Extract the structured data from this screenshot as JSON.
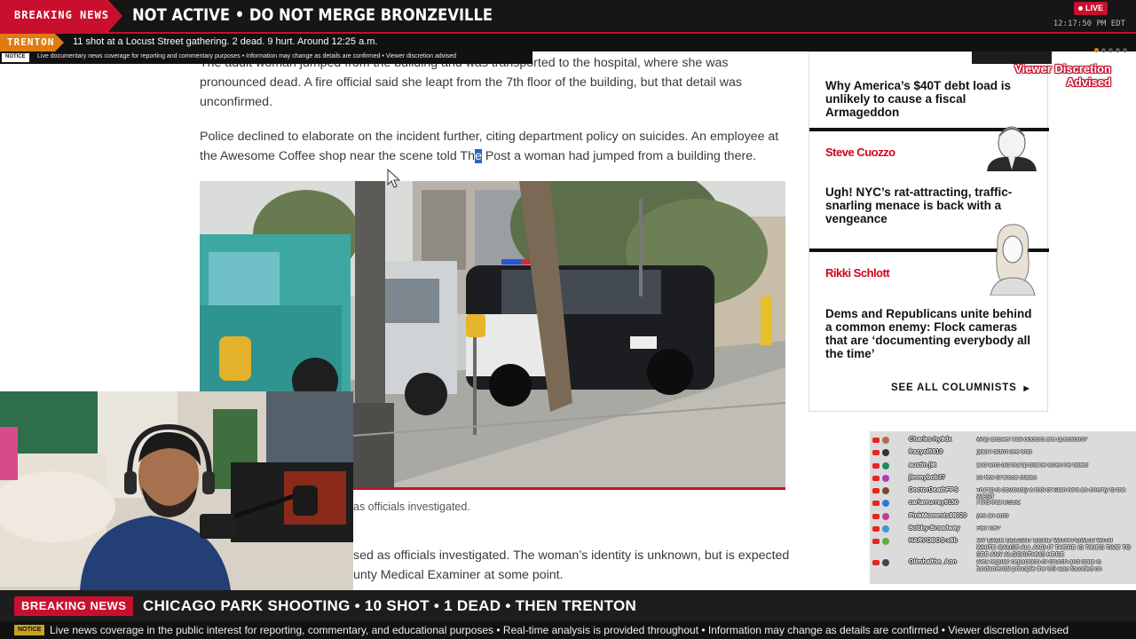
{
  "top_bar": {
    "breaking_label": "BREAKING NEWS",
    "headline": "NOT ACTIVE • DO NOT MERGE BRONZEVILLE",
    "live_label": "LIVE",
    "clock": "12:17:50 PM EDT"
  },
  "ticker2": {
    "tag": "TRENTON",
    "text": "11 shot at a Locust Street gathering. 2 dead. 9 hurt. Around 12:25 a.m."
  },
  "notice_strip": {
    "tag": "NOTICE",
    "text": "Live documentary news coverage for reporting and commentary purposes • Information may change as details are confirmed • Viewer discretion advised"
  },
  "article": {
    "para1": "The adult woman jumped from the building and was transported to the hospital, where she was pronounced dead. A fire official said she leapt from the 7th floor of the building, but that detail was unconfirmed.",
    "para2_before": "Police declined to elaborate on the incident further, citing department policy on suicides. An employee at the Awesome Coffee shop near the scene told Th",
    "para2_highlight": "e",
    "para2_after": " Post a woman had jumped from a building there.",
    "caption_visible": "as officials investigated.",
    "para3_line1": "sed as officials investigated. The woman’s identity is unknown, but is expected",
    "para3_line2": "unty Medical Examiner at some point."
  },
  "sidebar": {
    "headline1": "Why America’s $40T debt load is unlikely to cause a fiscal Armageddon",
    "author1": "Steve Cuozzo",
    "headline2": "Ugh! NYC’s rat-attracting, traffic-snarling menace is back with a vengeance",
    "author2": "Rikki Schlott",
    "headline3": "Dems and Republicans unite behind a common enemy: Flock cameras that are ‘documenting everybody all the time’",
    "see_all": "SEE ALL COLUMNISTS",
    "see_all_icon": "triangle-right-icon"
  },
  "viewer_discretion": "Viewer Discretion Advised",
  "chat": {
    "messages": [
      {
        "user": "Charles-hy9dx",
        "text": "Why answer that doctors are questions?",
        "avatar_color": "#b86b4b"
      },
      {
        "user": "frazyol5510",
        "text": "glad I didn't see that",
        "avatar_color": "#333333"
      },
      {
        "user": "austin j9t",
        "text": "and who did trump blame when he failed",
        "avatar_color": "#1f8a5b"
      },
      {
        "user": "jimmybob37",
        "text": "so few of those states",
        "avatar_color": "#b23bb5"
      },
      {
        "user": "DoctorDeathFPS",
        "text": "Trump is obviously a tool of Stan he's an enemy to the WEST",
        "avatar_color": "#7a4a2a"
      },
      {
        "user": "carlamurray9150",
        "text": "I find that BSBC",
        "avatar_color": "#2a7bd1"
      },
      {
        "user": "PinkMoments98020",
        "text": "yes an auto",
        "avatar_color": "#c23f8f"
      },
      {
        "user": "Bobby-Broadway",
        "text": "Fair ice?",
        "avatar_color": "#3a9ad1"
      },
      {
        "user": "HARVOBOS-x6b",
        "text": "MY BACK DOESNT COME WITH POWER WITH WHITE CAUSE ALL AND IT THERE IS TIMES TIME TO SEE ANY ALGORITHMS HERE",
        "avatar_color": "#5fae3a"
      },
      {
        "user": "Olimhalthe_Aon",
        "text": "Alex regular separation of church and state is fundamental principle the US was founded on",
        "avatar_color": "#444444"
      }
    ]
  },
  "bottom_bar": {
    "breaking_label": "BREAKING NEWS",
    "headline": "CHICAGO PARK SHOOTING • 10 SHOT • 1 DEAD • THEN TRENTON",
    "notice_tag": "NOTICE",
    "notice_text": "Live news coverage in the public interest for reporting, commentary, and educational purposes • Real-time analysis is provided throughout • Information may change as details are confirmed • Viewer discretion advised"
  },
  "colors": {
    "accent_red": "#c8102e",
    "trenton_orange": "#e07b12",
    "sidebar_author_red": "#d0021b",
    "selection_blue": "#2f62c9"
  }
}
